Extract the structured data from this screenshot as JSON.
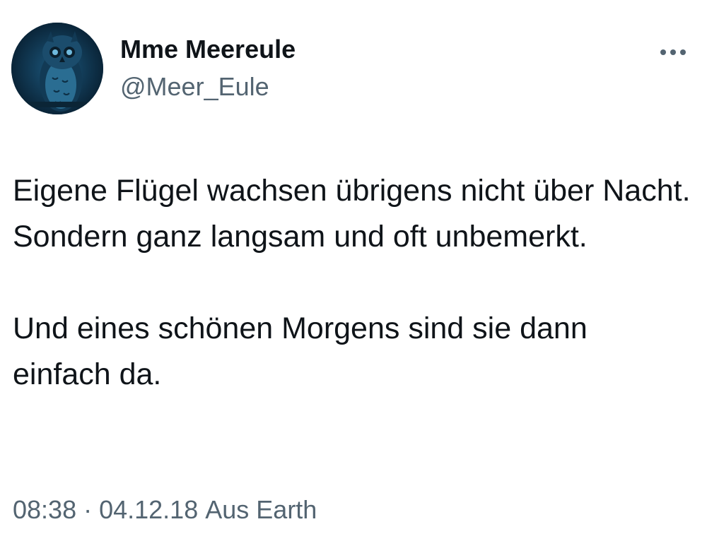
{
  "author": {
    "display_name": "Mme Meereule",
    "handle": "@Meer_Eule",
    "avatar_icon": "owl-avatar-icon"
  },
  "menu": {
    "icon": "more-options-icon",
    "glyph": "•••"
  },
  "tweet": {
    "paragraph_1": "Eigene Flügel wachsen übrigens nicht über Nacht. Sondern ganz langsam und oft unbemerkt.",
    "paragraph_2": "Und eines schönen Morgens sind sie dann einfach da."
  },
  "meta": {
    "time": "08:38",
    "separator": "·",
    "date": "04.12.18",
    "source": "Aus Earth"
  },
  "colors": {
    "text": "#0f1419",
    "secondary": "#536471",
    "avatar_bg": "#0a2a40"
  }
}
